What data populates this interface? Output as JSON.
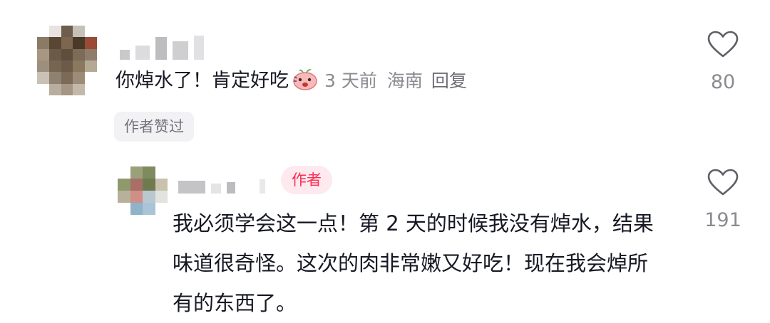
{
  "comment": {
    "text": "你焯水了！肯定好吃",
    "emoji_icon": "peach-face-emoji",
    "time": "3 天前",
    "location": "海南",
    "reply_label": "回复",
    "like_count": "80",
    "liked_by_author": "作者赞过"
  },
  "reply": {
    "author_badge": "作者",
    "text": "我必须学会这一点！第 2 天的时候我没有焯水，结果味道很奇怪。这次的肉非常嫩又好吃！现在我会焯所有的东西了。",
    "like_count": "191"
  },
  "colors": {
    "accent": "#fe2c55",
    "badge_bg": "#fde9ee",
    "meta_text": "#8a8b91",
    "chip_bg": "#f2f2f4"
  }
}
